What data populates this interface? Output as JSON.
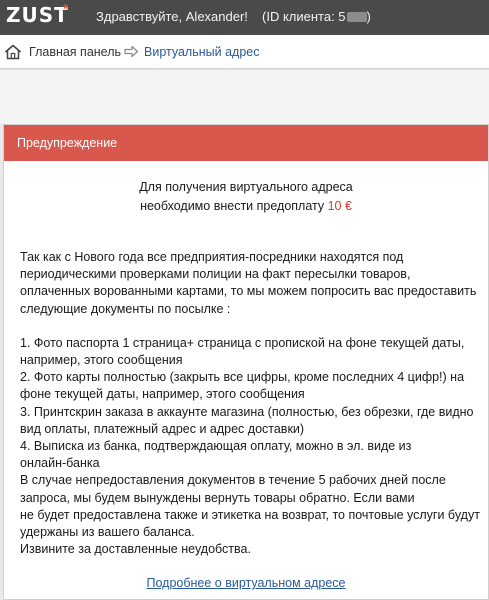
{
  "header": {
    "logo": "ZUST",
    "logo_mark": "*",
    "greeting": "Здравствуйте, Alexander!",
    "client_id_prefix": "(ID клиента: 5",
    "client_id_suffix": ")"
  },
  "breadcrumb": {
    "home_icon": "home-icon",
    "home_label": "Главная панель",
    "separator_icon": "arrow-right-icon",
    "current_label": "Виртуальный адрес"
  },
  "modal": {
    "title": "Предупреждение",
    "intro_line1": "Для получения виртуального адреса",
    "intro_line2_prefix": "необходимо внести предоплату ",
    "intro_amount": "10 €",
    "paragraph_lines": [
      "Так как с Нового года все предприятия-посредники находятся под",
      "периодическими проверками полиции на факт пересылки товаров,",
      "оплаченных ворованными картами, то мы можем попросить вас предоставить",
      "следующие документы по посылке :"
    ],
    "items_lines": [
      "1. Фото паспорта 1 страница+ страница с пропиской на фоне текущей даты,",
      "например, этого сообщения",
      "2. Фото карты полностью (закрыть все цифры, кроме последних 4 цифр!) на",
      "фоне текущей даты, например, этого сообщения",
      "3. Принтскрин заказа в аккаунте магазина (полностью, без обрезки, где видно",
      "вид оплаты, платежный адрес и адрес доставки)",
      "4. Выписка из банка, подтверждающая оплату, можно в эл. виде из",
      "онлайн-банка",
      "В случае непредоставления документов в течение 5 рабочих дней после",
      "запроса, мы будем вынуждены вернуть товары обратно. Если вами",
      "не будет предоставлена также и этикетка на возврат, то почтовые услуги будут",
      "удержаны из вашего баланса.",
      "Извините за доставленные неудобства."
    ],
    "more_link": "Подробнее о виртуальном адресе"
  },
  "colors": {
    "topbar": "#4a4a4a",
    "logo_mark": "#e8532b",
    "modal_header": "#d9584d",
    "link": "#2a5a99",
    "price": "#d93a2b"
  }
}
